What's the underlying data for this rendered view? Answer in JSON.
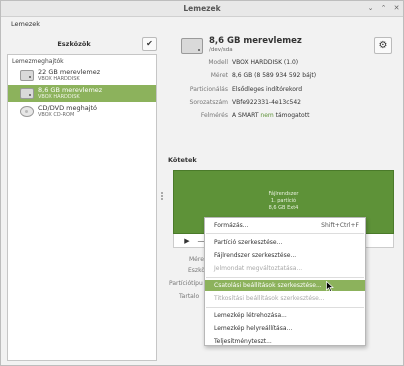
{
  "window": {
    "title": "Lemezek",
    "minimize": "⌄",
    "maximize": "⌃",
    "close": "✕"
  },
  "menubar": {
    "label": "Lemezek"
  },
  "sidebar": {
    "title": "Eszközök",
    "check_icon": "✔",
    "section_label": "Lemezmeghajtók",
    "drives": [
      {
        "name": "22 GB merevlemez",
        "sub": "VBOX HARDDISK",
        "icon": "hdd-icon"
      },
      {
        "name": "8,6 GB merevlemez",
        "sub": "VBOX HARDDISK",
        "icon": "hdd-icon",
        "selected": true
      },
      {
        "name": "CD/DVD meghajtó",
        "sub": "VBOX CD-ROM",
        "icon": "disc-icon"
      }
    ]
  },
  "disk": {
    "title": "8,6 GB merevlemez",
    "subtitle": "/dev/sda",
    "gear_icon": "⚙",
    "properties": [
      {
        "label": "Modell",
        "value": "VBOX HARDDISK (1.0)"
      },
      {
        "label": "Méret",
        "value": "8,6 GB (8 589 934 592 bájt)"
      },
      {
        "label": "Particionálás",
        "value": "Elsődleges indítórekord"
      },
      {
        "label": "Sorozatszám",
        "value": "VBfe922331-4e13c542"
      },
      {
        "label": "Felmérés",
        "value_prefix": "A SMART ",
        "value_link": "nem",
        "value_suffix": " támogatott"
      }
    ]
  },
  "volumes": {
    "title": "Kötetek",
    "volume_lines": [
      "Fájlrendszer",
      "1. partíció",
      "8,6 GB Ext4"
    ],
    "toolbar": {
      "play": "▶",
      "minus": "—",
      "tools": "⚙"
    },
    "labels": [
      "Méret",
      "Eszköz",
      "Partíciótípus",
      "Tartalom"
    ],
    "label_fragments": [
      "Mére",
      "Eszkö",
      "Partíciótípu",
      "Tartalo"
    ]
  },
  "context_menu": {
    "items": [
      {
        "label": "Formázás...",
        "shortcut": "Shift+Ctrl+F",
        "disabled": false
      },
      {
        "label": "Partíció szerkesztése...",
        "disabled": false
      },
      {
        "label": "Fájlrendszer szerkesztése...",
        "disabled": false
      },
      {
        "label": "Jelmondat megváltoztatása...",
        "disabled": true
      },
      {
        "label": "Csatolási beállítások szerkesztése...",
        "disabled": false,
        "highlighted": true
      },
      {
        "label": "Titkosítási beállítások szerkesztése...",
        "disabled": true
      },
      {
        "label": "Lemezkép létrehozása...",
        "disabled": false
      },
      {
        "label": "Lemezkép helyreállítása...",
        "disabled": false
      },
      {
        "label": "Teljesítményteszt...",
        "disabled": false
      }
    ]
  }
}
